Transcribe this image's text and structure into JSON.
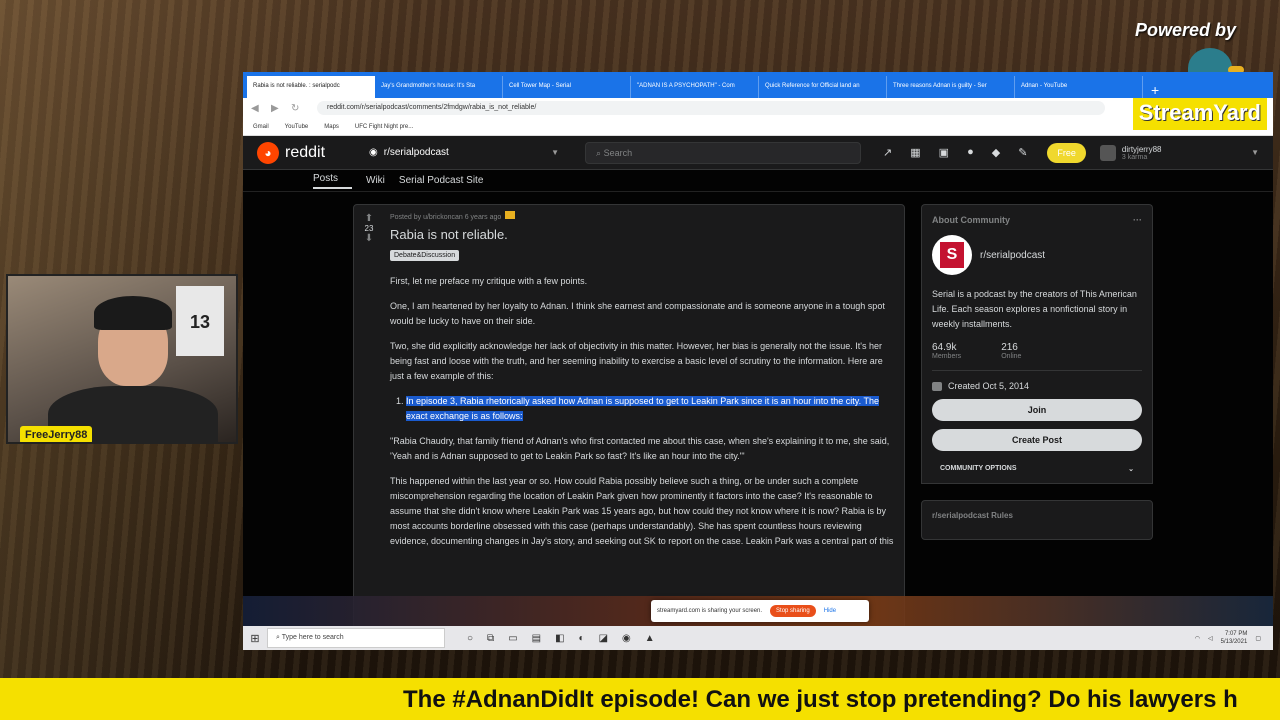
{
  "overlay": {
    "powered_by": "Powered by",
    "streamyard_logo": "StreamYard",
    "presenter_name": "FreeJerry88",
    "ticker_text": "The #AdnanDidIt episode! Can we just stop pretending? Do his lawyers h",
    "jersey_text": "13"
  },
  "browser": {
    "tabs": [
      "Rabia is not reliable. : serialpodc",
      "Jay's Grandmother's house: It's Sta",
      "Cell Tower Map - Serial",
      "\"ADNAN IS A PSYCHOPATH\" - Com",
      "Quick Reference for Official land an",
      "Three reasons Adnan is guilty - Ser",
      "Adnan - YouTube"
    ],
    "url": "reddit.com/r/serialpodcast/comments/2fmdgw/rabia_is_not_reliable/",
    "bookmarks": [
      "Gmail",
      "YouTube",
      "Maps",
      "UFC Fight Night pre..."
    ]
  },
  "reddit": {
    "wordmark": "reddit",
    "subreddit": "r/serialpodcast",
    "search_placeholder": "Search",
    "free_label": "Free",
    "username": "dirtyjerry88",
    "karma": "3 karma",
    "subnav": [
      "Posts",
      "Wiki",
      "Serial Podcast Site"
    ],
    "post": {
      "meta": "Posted by u/brickoncan 6 years ago",
      "votes": "23",
      "title": "Rabia is not reliable.",
      "flair": "Debate&Discussion",
      "p1": "First, let me preface my critique with a few points.",
      "p2": "One, I am heartened by her loyalty to Adnan. I think she earnest and compassionate and is someone anyone in a tough spot would be lucky to have on their side.",
      "p3": "Two, she did explicitly acknowledge her lack of objectivity in this matter. However, her bias is generally not the issue. It's her being fast and loose with the truth, and her seeming inability to exercise a basic level of scrutiny to the information. Here are just a few example of this:",
      "li1": "In episode 3, Rabia rhetorically asked how Adnan is supposed to get to Leakin Park since it is an hour into the city. The exact exchange is as follows:",
      "quote": "\"Rabia Chaudry, that family friend of Adnan's who first contacted me about this case, when she's explaining it to me, she said, 'Yeah and is Adnan supposed to get to Leakin Park so fast? It's like an hour into the city.'\"",
      "p4": "This happened within the last year or so. How could Rabia possibly believe such a thing, or be under such a complete miscomprehension regarding the location of Leakin Park given how prominently it factors into the case? It's reasonable to assume that she didn't know where Leakin Park was 15 years ago, but how could they not know where it is now? Rabia is by most accounts borderline obsessed with this case (perhaps understandably). She has spent countless hours reviewing evidence, documenting changes in Jay's story, and seeking out SK to report on the case. Leakin Park was a central part of this"
    },
    "sidebar": {
      "about_title": "About Community",
      "community_name": "r/serialpodcast",
      "icon_letter": "S",
      "description": "Serial is a podcast by the creators of This American Life. Each season explores a nonfictional story in weekly installments.",
      "members_value": "64.9k",
      "members_label": "Members",
      "online_value": "216",
      "online_label": "Online",
      "created": "Created Oct 5, 2014",
      "join_label": "Join",
      "create_post_label": "Create Post",
      "options_label": "COMMUNITY OPTIONS",
      "rules_title": "r/serialpodcast Rules"
    }
  },
  "share_bar": {
    "text": "streamyard.com is sharing your screen.",
    "stop_label": "Stop sharing",
    "hide_label": "Hide"
  },
  "taskbar": {
    "search_placeholder": "Type here to search",
    "time": "7:07 PM",
    "date": "5/13/2021"
  }
}
